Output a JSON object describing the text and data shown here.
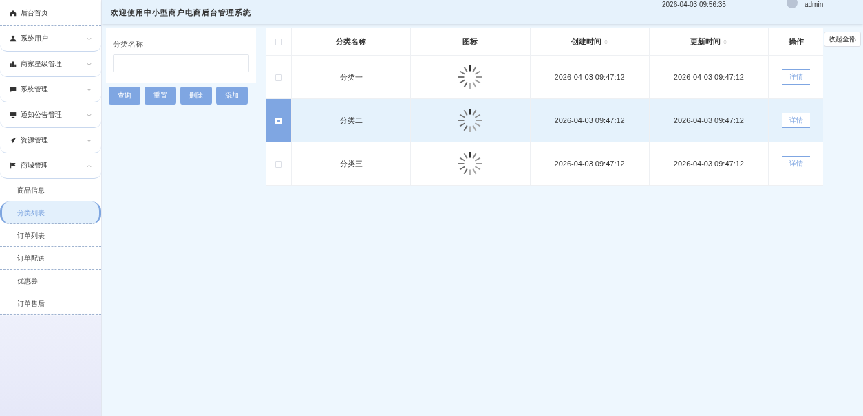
{
  "sidebar": {
    "items": [
      {
        "label": "后台首页",
        "kind": "link"
      },
      {
        "label": "系统用户",
        "kind": "group",
        "expanded": false
      },
      {
        "label": "商家星级管理",
        "kind": "group",
        "expanded": false
      },
      {
        "label": "系统管理",
        "kind": "group",
        "expanded": false
      },
      {
        "label": "通知公告管理",
        "kind": "group",
        "expanded": false
      },
      {
        "label": "资源管理",
        "kind": "group",
        "expanded": false
      },
      {
        "label": "商城管理",
        "kind": "group",
        "expanded": true,
        "children": [
          {
            "label": "商品信息",
            "selected": false
          },
          {
            "label": "分类列表",
            "selected": true
          },
          {
            "label": "订单列表",
            "selected": false
          },
          {
            "label": "订单配送",
            "selected": false
          },
          {
            "label": "优惠券",
            "selected": false
          },
          {
            "label": "订单售后",
            "selected": false
          }
        ]
      }
    ]
  },
  "header": {
    "title": "欢迎使用中小型商户电商后台管理系统",
    "time": "2026-04-03 09:56:35",
    "user": "admin"
  },
  "filter": {
    "label": "分类名称",
    "buttons": [
      "查询",
      "重置",
      "删除",
      "添加"
    ]
  },
  "collapse_button": "收起全部",
  "table": {
    "select_all": {
      "checked": false
    },
    "columns": [
      {
        "label": "分类名称",
        "sortable": false
      },
      {
        "label": "图标",
        "sortable": false
      },
      {
        "label": "创建时间",
        "sortable": true
      },
      {
        "label": "更新时间",
        "sortable": true
      },
      {
        "label": "操作",
        "sortable": false
      }
    ],
    "rows": [
      {
        "selected": false,
        "name": "分类一",
        "created": "2026-04-03 09:47:12",
        "updated": "2026-04-03 09:47:12",
        "action": "详情"
      },
      {
        "selected": true,
        "name": "分类二",
        "created": "2026-04-03 09:47:12",
        "updated": "2026-04-03 09:47:12",
        "action": "详情"
      },
      {
        "selected": false,
        "name": "分类三",
        "created": "2026-04-03 09:47:12",
        "updated": "2026-04-03 09:47:12",
        "action": "详情"
      }
    ]
  }
}
